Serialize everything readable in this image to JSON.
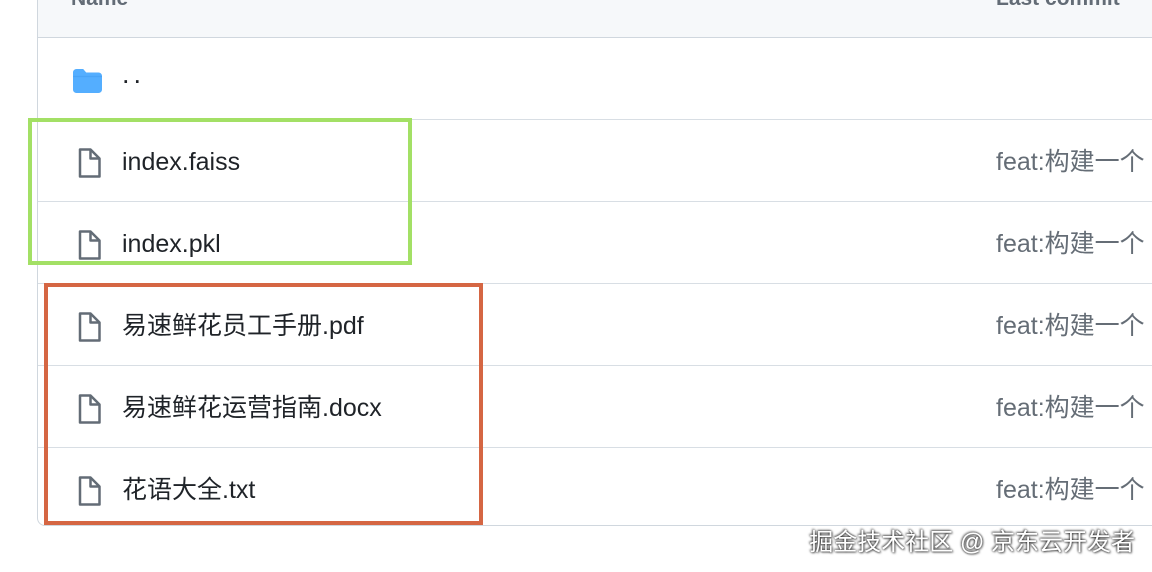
{
  "table": {
    "header": {
      "name": "Name",
      "last_commit": "Last commit"
    },
    "rows": [
      {
        "name": "..",
        "icon": "folder-icon",
        "commit": ""
      },
      {
        "name": "index.faiss",
        "icon": "file-icon",
        "commit": "feat:构建一个"
      },
      {
        "name": "index.pkl",
        "icon": "file-icon",
        "commit": "feat:构建一个"
      },
      {
        "name": "易速鲜花员工手册.pdf",
        "icon": "file-icon",
        "commit": "feat:构建一个"
      },
      {
        "name": "易速鲜花运营指南.docx",
        "icon": "file-icon",
        "commit": "feat:构建一个"
      },
      {
        "name": "花语大全.txt",
        "icon": "file-icon",
        "commit": "feat:构建一个"
      }
    ]
  },
  "colors": {
    "folder_icon": "#54aeff",
    "file_icon": "#636c76",
    "highlight_green": "#a3e065",
    "highlight_red": "#d56643",
    "border": "#d0d7de"
  },
  "watermark": "掘金技术社区 @ 京东云开发者"
}
